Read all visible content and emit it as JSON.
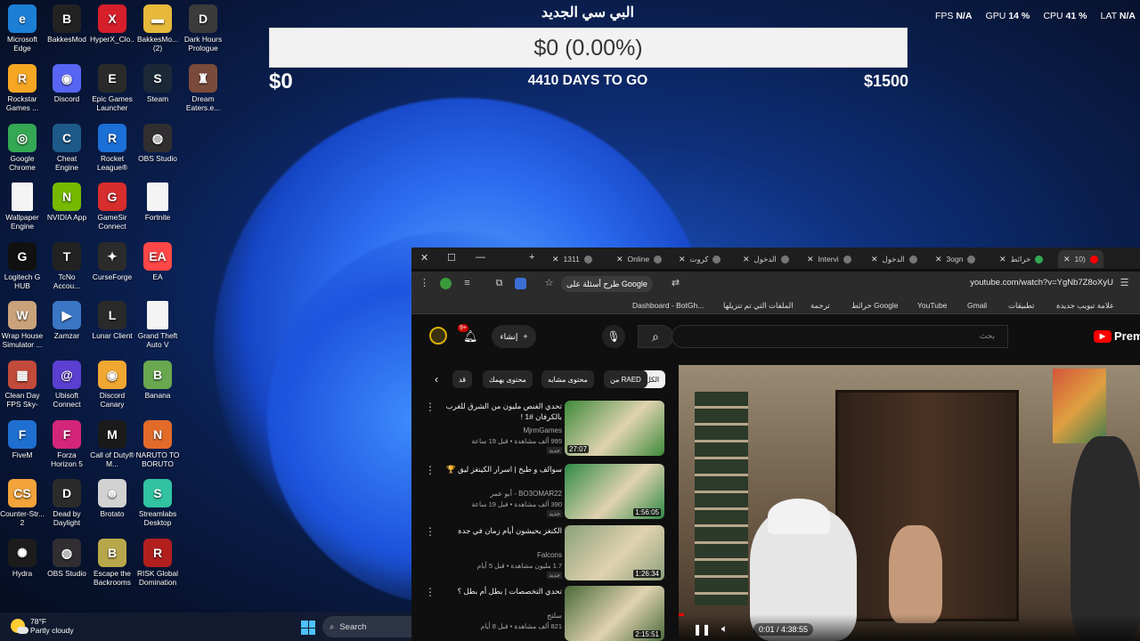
{
  "overlay": {
    "title": "البي سي الجديد",
    "progress_text": "$0 (0.00%)",
    "progress_fraction": 0.0,
    "min_label": "$0",
    "days_label": "4410 DAYS TO GO",
    "max_label": "$1500"
  },
  "stats": {
    "fps_label": "FPS",
    "fps_value": "N/A",
    "gpu_label": "GPU",
    "gpu_value": "14 %",
    "cpu_label": "CPU",
    "cpu_value": "41 %",
    "lat_label": "LAT",
    "lat_value": "N/A"
  },
  "desktop_icons": [
    {
      "label": "Microsoft Edge",
      "icon": "edge-icon",
      "color": "#1b7fd6",
      "glyph": "e"
    },
    {
      "label": "BakkesMod",
      "icon": "bakkesmod-icon",
      "color": "#222222",
      "glyph": "B"
    },
    {
      "label": "HyperX_Clo...",
      "icon": "hyperx-icon",
      "color": "#d51f2b",
      "glyph": "X"
    },
    {
      "label": "BakkesMo... (2)",
      "icon": "folder-icon",
      "color": "#e7b93b",
      "glyph": "▬"
    },
    {
      "label": "Dark Hours Prologue",
      "icon": "dark-hours-icon",
      "color": "#3b3b3b",
      "glyph": "D"
    },
    {
      "label": "Rockstar Games ...",
      "icon": "rockstar-icon",
      "color": "#f5a623",
      "glyph": "R"
    },
    {
      "label": "Discord",
      "icon": "discord-icon",
      "color": "#5865f2",
      "glyph": "◉"
    },
    {
      "label": "Epic Games Launcher",
      "icon": "epic-games-icon",
      "color": "#2a2a2a",
      "glyph": "E"
    },
    {
      "label": "Steam",
      "icon": "steam-icon",
      "color": "#1b2838",
      "glyph": "S"
    },
    {
      "label": "Dream Eaters.e...",
      "icon": "dream-eaters-icon",
      "color": "#7a4a3a",
      "glyph": "♜"
    },
    {
      "label": "Google Chrome",
      "icon": "chrome-icon",
      "color": "#34a853",
      "glyph": "◎"
    },
    {
      "label": "Cheat Engine",
      "icon": "cheat-engine-icon",
      "color": "#1d5a8a",
      "glyph": "C"
    },
    {
      "label": "Rocket League®",
      "icon": "rocket-league-icon",
      "color": "#1b6fd6",
      "glyph": "R"
    },
    {
      "label": "OBS Studio",
      "icon": "obs-icon",
      "color": "#302e31",
      "glyph": "◍"
    },
    {
      "label": "Wallpaper Engine",
      "icon": "file-icon",
      "color": "#f4f4f4",
      "glyph": ""
    },
    {
      "label": "NVIDIA App",
      "icon": "nvidia-icon",
      "color": "#76b900",
      "glyph": "N"
    },
    {
      "label": "GameSir Connect",
      "icon": "gamesir-icon",
      "color": "#d62d2d",
      "glyph": "G"
    },
    {
      "label": "Fortnite",
      "icon": "file-icon",
      "color": "#f4f4f4",
      "glyph": ""
    },
    {
      "label": "Logitech G HUB",
      "icon": "logitech-icon",
      "color": "#111111",
      "glyph": "G"
    },
    {
      "label": "TcNo Accou...",
      "icon": "tcno-icon",
      "color": "#222222",
      "glyph": "T"
    },
    {
      "label": "CurseForge",
      "icon": "curseforge-icon",
      "color": "#2b2b2b",
      "glyph": "✦"
    },
    {
      "label": "EA",
      "icon": "ea-icon",
      "color": "#ff4747",
      "glyph": "EA"
    },
    {
      "label": "Wrap House Simulator ...",
      "icon": "wrap-house-icon",
      "color": "#c9a27a",
      "glyph": "W"
    },
    {
      "label": "Zamzar",
      "icon": "zamzar-icon",
      "color": "#3a76c4",
      "glyph": "▶"
    },
    {
      "label": "Lunar Client",
      "icon": "lunar-client-icon",
      "color": "#2a2a2a",
      "glyph": "L"
    },
    {
      "label": "Grand Theft Auto V",
      "icon": "file-icon",
      "color": "#f4f4f4",
      "glyph": ""
    },
    {
      "label": "Clean Day FPS Sky-Pa...",
      "icon": "clean-day-icon",
      "color": "#c24a3a",
      "glyph": "▦"
    },
    {
      "label": "Ubisoft Connect",
      "icon": "ubisoft-icon",
      "color": "#5a3fd0",
      "glyph": "@"
    },
    {
      "label": "Discord Canary",
      "icon": "discord-canary-icon",
      "color": "#f0a732",
      "glyph": "◉"
    },
    {
      "label": "Banana",
      "icon": "banana-icon",
      "color": "#6aa84f",
      "glyph": "B"
    },
    {
      "label": "FiveM",
      "icon": "fivem-icon",
      "color": "#1f6fd0",
      "glyph": "F"
    },
    {
      "label": "Forza Horizon 5",
      "icon": "forza-icon",
      "color": "#d3267a",
      "glyph": "F"
    },
    {
      "label": "Call of Duty® M...",
      "icon": "call-of-duty-icon",
      "color": "#1a1a1a",
      "glyph": "M"
    },
    {
      "label": "NARUTO TO BORUTO S...",
      "icon": "naruto-icon",
      "color": "#e36b2a",
      "glyph": "N"
    },
    {
      "label": "Counter-Str... 2",
      "icon": "counter-strike-icon",
      "color": "#f2a33a",
      "glyph": "CS"
    },
    {
      "label": "Dead by Daylight",
      "icon": "dead-by-daylight-icon",
      "color": "#2b2b2b",
      "glyph": "D"
    },
    {
      "label": "Brotato",
      "icon": "brotato-icon",
      "color": "#d2d2d2",
      "glyph": "☻"
    },
    {
      "label": "Streamlabs Desktop",
      "icon": "streamlabs-icon",
      "color": "#31c3a2",
      "glyph": "S"
    },
    {
      "label": "Hydra",
      "icon": "hydra-icon",
      "color": "#1c1c1c",
      "glyph": "✺"
    },
    {
      "label": "OBS Studio",
      "icon": "obs-icon",
      "color": "#302e31",
      "glyph": "◍"
    },
    {
      "label": "Escape the Backrooms",
      "icon": "backrooms-icon",
      "color": "#b8a74a",
      "glyph": "B"
    },
    {
      "label": "RISK Global Domination",
      "icon": "risk-icon",
      "color": "#b21f1f",
      "glyph": "R"
    }
  ],
  "browser": {
    "window_controls": {
      "close": "✕",
      "maximize": "☐",
      "minimize": "—"
    },
    "tabs": [
      {
        "label": "1311",
        "icon": "tab-icon"
      },
      {
        "label": "Online",
        "icon": "tab-icon"
      },
      {
        "label": "كروت",
        "icon": "tab-icon"
      },
      {
        "label": "الدخول",
        "icon": "tab-icon"
      },
      {
        "label": "Intervi",
        "icon": "tab-icon"
      },
      {
        "label": "الدخول",
        "icon": "tab-icon"
      },
      {
        "label": "3ogn",
        "icon": "tab-icon"
      },
      {
        "label": "خرائط",
        "icon": "maps-icon"
      },
      {
        "label": "10)",
        "icon": "youtube-icon",
        "active": true
      }
    ],
    "new_tab": "+",
    "url": "youtube.com/watch?v=YgNb7Z8oXyU",
    "ask_google": "طرح أسئلة على Google",
    "bookmarks": [
      {
        "label": "Dashboard - BotGh..."
      },
      {
        "label": "الملفات التي تم تنزيلها"
      },
      {
        "label": "ترجمة"
      },
      {
        "label": "خرائط Google"
      },
      {
        "label": "YouTube"
      },
      {
        "label": "Gmail"
      },
      {
        "label": "تطبيقات"
      },
      {
        "label": "علامة تبويب جديدة"
      }
    ]
  },
  "youtube": {
    "search_placeholder": "بحث",
    "create_label": "إنشاء",
    "notification_count": "9+",
    "logo_text": "Premi",
    "chips": [
      "الكل",
      "من RAED",
      "محتوى مشابه",
      "محتوى يهمك",
      "قد"
    ],
    "recommendations": [
      {
        "title": "تحدي الغنص مليون من الشرق للغرب بالكرفان #1 !",
        "channel": "MjrmGames",
        "meta": "995 ألف مشاهدة • قبل 19 ساعة",
        "badge": "جديد",
        "duration": "27:07",
        "thumb": "#3d8a3a"
      },
      {
        "title": "سوالف و طبخ | اسرار الكينغز ليق 🏆",
        "channel": "BO3OMAR22 - أبو عمر",
        "meta": "390 ألف مشاهدة • قبل 19 ساعة",
        "badge": "جديد",
        "duration": "1:56:05",
        "thumb": "#2f8a46"
      },
      {
        "title": "الكنغز يحيشون أيام زمان في جدة",
        "channel": "Falcons",
        "meta": "1.7 مليون مشاهدة • قبل 5 أيام",
        "badge": "جديد",
        "duration": "1:26:34",
        "thumb": "#8aa07a"
      },
      {
        "title": "تحدي التخصصات | بطل أم بطل ؟",
        "channel": "سلتح",
        "meta": "821 ألف مشاهدة • قبل 8 أيام",
        "badge": "",
        "duration": "2:15:51",
        "thumb": "#4a6a3a"
      }
    ],
    "player_time": "0:01 / 4:38:55"
  },
  "taskbar": {
    "temperature": "78°F",
    "weather": "Partly cloudy",
    "search_label": "Search"
  }
}
